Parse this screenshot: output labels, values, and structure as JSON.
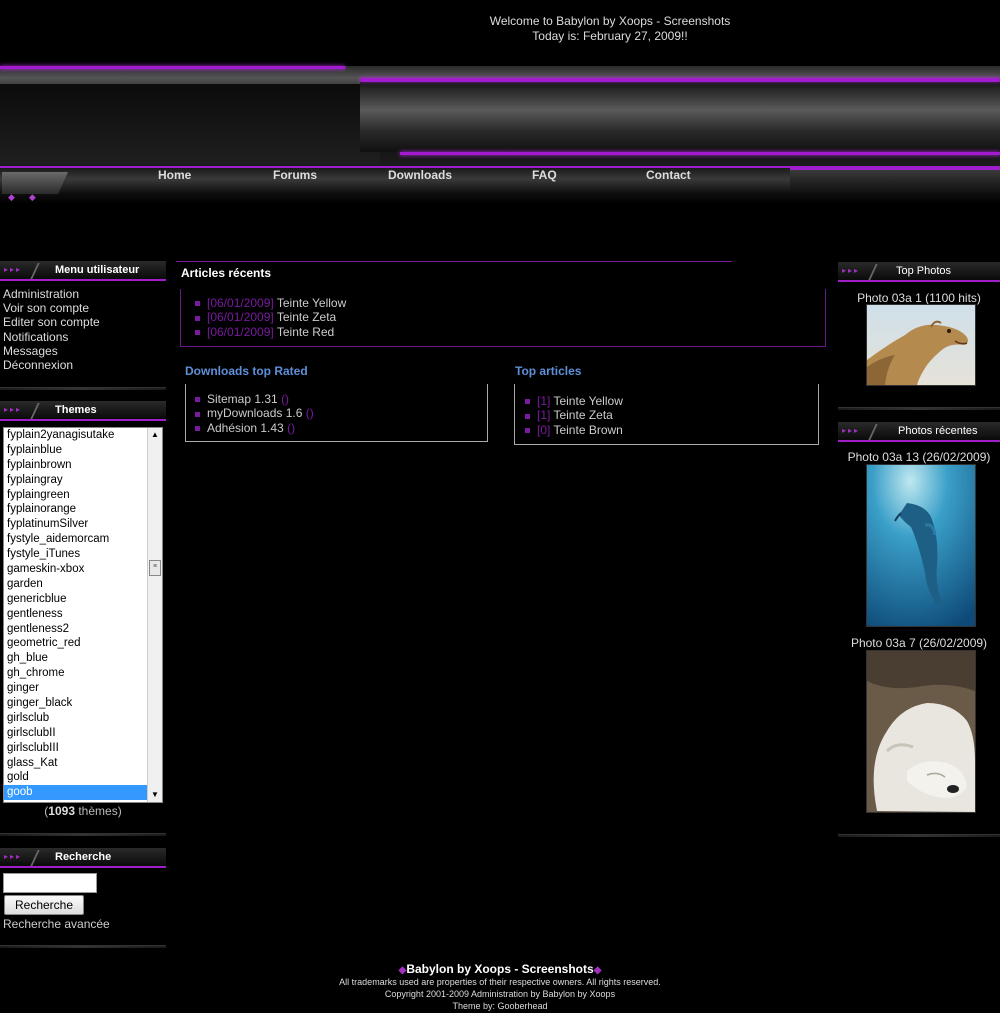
{
  "header": {
    "welcome": "Welcome to Babylon by Xoops - Screenshots",
    "date": "Today is: February 27, 2009!!"
  },
  "nav": [
    "Home",
    "Forums",
    "Downloads",
    "FAQ",
    "Contact"
  ],
  "user_menu": {
    "title": "Menu utilisateur",
    "items": [
      "Administration",
      "Voir son compte",
      "Editer son compte",
      "Notifications",
      "Messages",
      "Déconnexion"
    ]
  },
  "themes": {
    "title": "Themes",
    "options": [
      "fyplain2yanagisutake",
      "fyplainblue",
      "fyplainbrown",
      "fyplaingray",
      "fyplaingreen",
      "fyplainorange",
      "fyplatinumSilver",
      "fystyle_aidemorcam",
      "fystyle_iTunes",
      "gameskin-xbox",
      "garden",
      "genericblue",
      "gentleness",
      "gentleness2",
      "geometric_red",
      "gh_blue",
      "gh_chrome",
      "ginger",
      "ginger_black",
      "girlsclub",
      "girlsclubII",
      "girlsclubIII",
      "glass_Kat",
      "gold",
      "goob"
    ],
    "selected": "goob",
    "count": "1093",
    "count_suffix": "thèmes)"
  },
  "search": {
    "title": "Recherche",
    "input_value": "",
    "button": "Recherche",
    "advanced": "Recherche avancée"
  },
  "articles": {
    "title": "Articles récents",
    "items": [
      {
        "date": "[06/01/2009]",
        "title": "Teinte Yellow"
      },
      {
        "date": "[06/01/2009]",
        "title": "Teinte Zeta"
      },
      {
        "date": "[06/01/2009]",
        "title": "Teinte Red"
      }
    ]
  },
  "downloads": {
    "title": "Downloads top Rated",
    "items": [
      {
        "title": "Sitemap 1.31",
        "extra": "()"
      },
      {
        "title": "myDownloads 1.6",
        "extra": "()"
      },
      {
        "title": "Adhésion 1.43",
        "extra": "()"
      }
    ]
  },
  "top_articles": {
    "title": "Top articles",
    "items": [
      {
        "count": "[1]",
        "title": "Teinte Yellow"
      },
      {
        "count": "[1]",
        "title": "Teinte Zeta"
      },
      {
        "count": "[0]",
        "title": "Teinte Brown"
      }
    ]
  },
  "top_photos": {
    "title": "Top Photos",
    "items": [
      {
        "caption": "Photo 03a 1 (1100 hits)",
        "subject": "camel"
      }
    ]
  },
  "recent_photos": {
    "title": "Photos récentes",
    "items": [
      {
        "caption": "Photo 03a 13 (26/02/2009)",
        "subject": "dolphin"
      },
      {
        "caption": "Photo 03a 7 (26/02/2009)",
        "subject": "polar-bear"
      }
    ]
  },
  "footer": {
    "title": "Babylon by Xoops - Screenshots",
    "trademarks": "All trademarks used are properties of their respective owners. All rights reserved.",
    "copyright": "Copyright 2001-2009 Administration by Babylon by Xoops",
    "theme_by": "Theme by: Gooberhead"
  },
  "colors": {
    "accent": "#a01ec8",
    "link_blue": "#5f8fd8",
    "background": "#000000"
  }
}
